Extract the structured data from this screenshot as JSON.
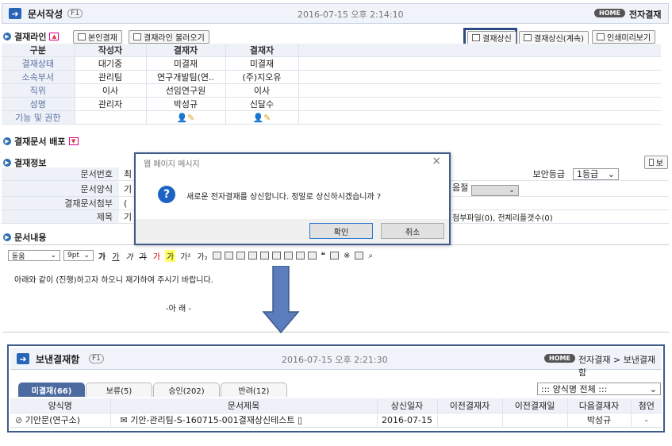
{
  "header": {
    "title": "문서작성",
    "help": "F1",
    "datetime": "2016-07-15 오후 2:14:10",
    "home": "HOME",
    "breadcrumb": "전자결재"
  },
  "approval_line": {
    "title": "결재라인",
    "buttons": {
      "my_approval": "본인결재",
      "load_line": "결재라인 불러오기",
      "submit": "결재상신",
      "submit_continue": "결재상신(계속)",
      "print_preview": "인쇄미리보기"
    },
    "columns": [
      "구분",
      "작성자",
      "결재자",
      "결재자"
    ],
    "rows": [
      {
        "label": "결재상태",
        "cells": [
          "대기중",
          "미결재",
          "미결재"
        ]
      },
      {
        "label": "소속부서",
        "cells": [
          "관리팀",
          "연구개발팀(연..",
          "(주)지오유"
        ]
      },
      {
        "label": "직위",
        "cells": [
          "이사",
          "선임연구원",
          "이사"
        ]
      },
      {
        "label": "성명",
        "cells": [
          "관리자",
          "박성규",
          "신달수"
        ]
      },
      {
        "label": "기능 및 권한",
        "cells": [
          "",
          "",
          ""
        ]
      }
    ]
  },
  "distribution": {
    "title": "결재문서 배포"
  },
  "approval_info": {
    "title": "결재정보",
    "fields": {
      "doc_number": "문서번호",
      "doc_form": "문서양식",
      "attachment": "결재문서첨부",
      "subject": "제목"
    },
    "truncated": {
      "doc_number": "최",
      "doc_form": "기",
      "attachment": "(",
      "subject": "기"
    },
    "security_label": "보안등급",
    "security_value": "1등급",
    "preservation": "음절",
    "attach_info": "첨부파일(0), 전체리플갯수(0)",
    "side_button": "보"
  },
  "content": {
    "title": "문서내용",
    "font": "돋움",
    "size": "9pt",
    "body_line1": "아래와 같이 (진행)하고자 하오니 재가하여 주시기 바랍니다.",
    "body_line2": "-아 래 -"
  },
  "dialog": {
    "title": "웹 페이지 메시지",
    "message": "새로운 전자결재를 상신합니다. 정말로 상신하시겠습니까 ?",
    "ok": "확인",
    "cancel": "취소"
  },
  "sent": {
    "title": "보낸결재함",
    "help": "F1",
    "datetime": "2016-07-15 오후 2:21:30",
    "home": "HOME",
    "breadcrumb": "전자결재 > 보낸결재함",
    "tabs": [
      "미결재(66)",
      "보류(5)",
      "승인(202)",
      "반려(12)"
    ],
    "filter": "::: 양식명 전체 :::",
    "columns": [
      "양식명",
      "문서제목",
      "상신일자",
      "이전결재자",
      "이전결재일",
      "다음결재자",
      "첨언"
    ],
    "row": [
      "기안문(연구소)",
      "기안-관리팀-S-160715-001결재상신테스트",
      "2016-07-15",
      "",
      "",
      "박성규",
      "-"
    ]
  },
  "colors": {
    "accent": "#3f5b8c",
    "header_bg": "#f0f4fa",
    "label_bg": "#eef2f8"
  }
}
